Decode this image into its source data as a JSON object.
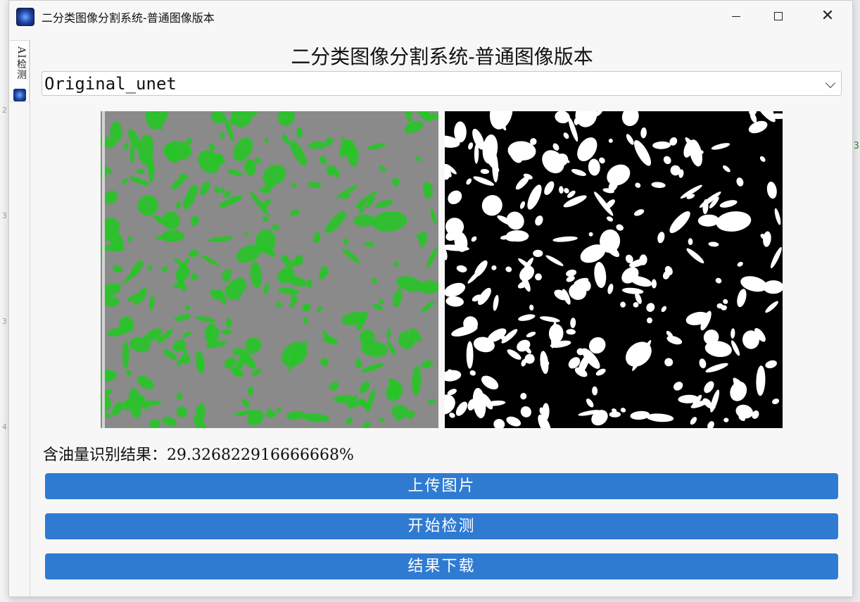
{
  "window": {
    "title": "二分类图像分割系统-普通图像版本",
    "controls": {
      "minimize": "minimize-icon",
      "maximize": "maximize-icon",
      "close": "close-icon"
    }
  },
  "sidebar": {
    "tab_label": "AI检测"
  },
  "main": {
    "heading": "二分类图像分割系统-普通图像版本",
    "model_select": {
      "value": "Original_unet"
    },
    "images": {
      "original": {
        "colors": {
          "background": "#8a8a8a",
          "blobs": "#27c427"
        }
      },
      "mask": {
        "colors": {
          "background": "#000000",
          "blobs": "#ffffff"
        }
      }
    },
    "result": {
      "label": "含油量识别结果：",
      "value": "29.326822916666668%"
    },
    "buttons": {
      "upload": "上传图片",
      "detect": "开始检测",
      "download": "结果下载"
    }
  },
  "colors": {
    "accent": "#2f7bd2"
  },
  "background_editor": {
    "right_digit": "3"
  }
}
